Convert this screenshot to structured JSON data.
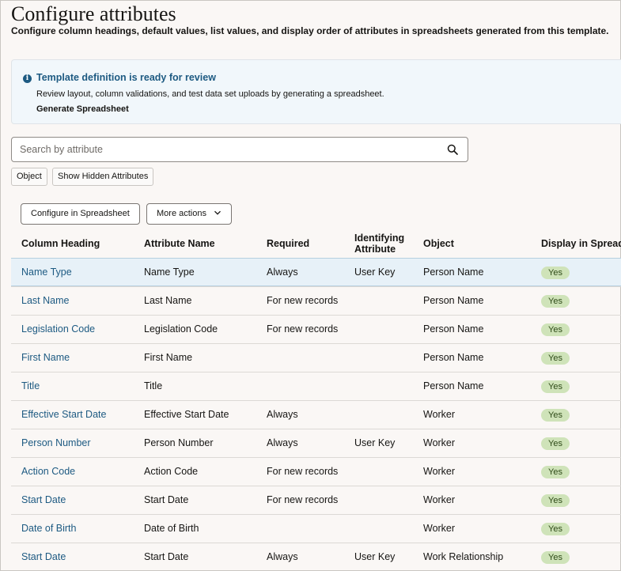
{
  "header": {
    "title": "Configure attributes",
    "subtitle": "Configure column headings, default values, list values, and display order of attributes in spreadsheets generated from this template."
  },
  "banner": {
    "icon": "info-icon",
    "title": "Template definition is ready for review",
    "text": "Review layout, column validations, and test data set uploads by generating a spreadsheet.",
    "link_label": "Generate Spreadsheet"
  },
  "search": {
    "placeholder": "Search by attribute",
    "value": "",
    "icon": "search-icon"
  },
  "filters": {
    "object_label": "Object",
    "hidden_label": "Show Hidden Attributes"
  },
  "toolbar": {
    "configure_label": "Configure in Spreadsheet",
    "more_actions_label": "More actions"
  },
  "table": {
    "columns": [
      "Column Heading",
      "Attribute Name",
      "Required",
      "Identifying Attribute",
      "Object",
      "Display in Spreadsheet"
    ],
    "rows": [
      {
        "heading": "Name Type",
        "attribute": "Name Type",
        "required": "Always",
        "identifying": "User Key",
        "object": "Person Name",
        "display": "Yes"
      },
      {
        "heading": "Last Name",
        "attribute": "Last Name",
        "required": "For new records",
        "identifying": "",
        "object": "Person Name",
        "display": "Yes"
      },
      {
        "heading": "Legislation Code",
        "attribute": "Legislation Code",
        "required": "For new records",
        "identifying": "",
        "object": "Person Name",
        "display": "Yes"
      },
      {
        "heading": "First Name",
        "attribute": "First Name",
        "required": "",
        "identifying": "",
        "object": "Person Name",
        "display": "Yes"
      },
      {
        "heading": "Title",
        "attribute": "Title",
        "required": "",
        "identifying": "",
        "object": "Person Name",
        "display": "Yes"
      },
      {
        "heading": "Effective Start Date",
        "attribute": "Effective Start Date",
        "required": "Always",
        "identifying": "",
        "object": "Worker",
        "display": "Yes"
      },
      {
        "heading": "Person Number",
        "attribute": "Person Number",
        "required": "Always",
        "identifying": "User Key",
        "object": "Worker",
        "display": "Yes"
      },
      {
        "heading": "Action Code",
        "attribute": "Action Code",
        "required": "For new records",
        "identifying": "",
        "object": "Worker",
        "display": "Yes"
      },
      {
        "heading": "Start Date",
        "attribute": "Start Date",
        "required": "For new records",
        "identifying": "",
        "object": "Worker",
        "display": "Yes"
      },
      {
        "heading": "Date of Birth",
        "attribute": "Date of Birth",
        "required": "",
        "identifying": "",
        "object": "Worker",
        "display": "Yes"
      },
      {
        "heading": "Start Date",
        "attribute": "Start Date",
        "required": "Always",
        "identifying": "User Key",
        "object": "Work Relationship",
        "display": "Yes"
      }
    ]
  },
  "colors": {
    "link": "#1d5a82",
    "badge_bg": "#cfe3b9",
    "selected_row": "#e7f1f8",
    "banner_bg": "#f1f7fb"
  }
}
